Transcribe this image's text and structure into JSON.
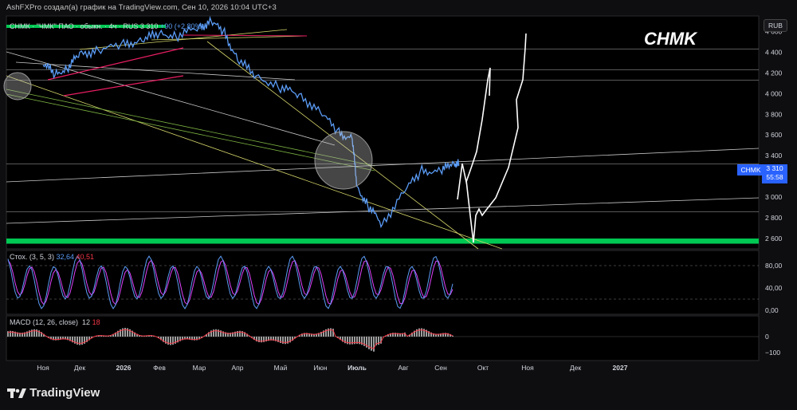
{
  "header": {
    "text": "AshFXPro создал(а) график на TradingView.com, Сен 10, 2026 10:04 UTC+3"
  },
  "symbol": {
    "legend": "СНМК · \"ЧМК\" ПАО · обыкн. · 4ч · RUS",
    "last": "3 310",
    "change": "+90 (+2,80%)"
  },
  "currency": "RUB",
  "annotation": "CHMK",
  "price_label": {
    "name": "CHMK",
    "value": "3 310",
    "countdown": "55:58"
  },
  "stoch": {
    "label": "Стох. (3, 5, 3)",
    "k": "32,64",
    "d": "40,51"
  },
  "macd": {
    "label": "MACD (12, 26, close)",
    "macd": "12",
    "signal": "18"
  },
  "brand": "TradingView",
  "colors": {
    "price": "#5b9cf6",
    "support": "#00c853",
    "stoch_k": "#5b9cf6",
    "stoch_d": "#e040fb",
    "hist": "#9e9e9e",
    "macd_line": "#f23645",
    "channel": "#e91e63"
  },
  "chart_data": [
    {
      "type": "line",
      "title": "СНМК · 4ч",
      "ylabel": "RUB",
      "x": [
        "Ноя",
        "Дек",
        "2026",
        "Фев",
        "Мар",
        "Апр",
        "Май",
        "Июн",
        "Июль",
        "Авг",
        "Сен",
        "Окт",
        "Ноя",
        "Дек",
        "2027"
      ],
      "ylim": [
        2500,
        4750
      ],
      "yticks": [
        "4 600",
        "4 400",
        "4 200",
        "4 000",
        "3 800",
        "3 600",
        "3 400",
        "3 200",
        "3 000",
        "2 800",
        "2 600"
      ],
      "ytick_values": [
        4600,
        4400,
        4200,
        4000,
        3800,
        3600,
        3400,
        3200,
        3000,
        2800,
        2600
      ],
      "series": [
        {
          "name": "СНМК",
          "points": [
            [
              "Ноя-01",
              4300
            ],
            [
              "Ноя-10",
              4180
            ],
            [
              "Ноя-20",
              4260
            ],
            [
              "Дек-01",
              4380
            ],
            [
              "Дек-15",
              4420
            ],
            [
              "2026-01",
              4470
            ],
            [
              "2026-15",
              4520
            ],
            [
              "Фев-01",
              4580
            ],
            [
              "Фев-15",
              4560
            ],
            [
              "Мар-01",
              4640
            ],
            [
              "Мар-10",
              4700
            ],
            [
              "Мар-20",
              4580
            ],
            [
              "Апр-01",
              4330
            ],
            [
              "Апр-15",
              4170
            ],
            [
              "Май-01",
              4060
            ],
            [
              "Май-15",
              3990
            ],
            [
              "Июн-01",
              3820
            ],
            [
              "Июн-15",
              3620
            ],
            [
              "Июн-25",
              3560
            ],
            [
              "Июль-01",
              3100
            ],
            [
              "Июль-10",
              2900
            ],
            [
              "Июль-20",
              2740
            ],
            [
              "Авг-01",
              3040
            ],
            [
              "Авг-15",
              3260
            ],
            [
              "Сен-01",
              3240
            ],
            [
              "Сен-10",
              3340
            ],
            [
              "Сен-15",
              3310
            ]
          ]
        }
      ],
      "support_zone": [
        2550,
        2600
      ],
      "horizontal_levels": [
        4430,
        4230,
        4130,
        3320,
        2860
      ],
      "forecast_drawing": "hand-drawn path: dip to ~2600, then rise to ~4700",
      "highlight_circles": 3
    },
    {
      "type": "line",
      "title": "Стох. (3, 5, 3)",
      "ylim": [
        0,
        100
      ],
      "yticks": [
        "80,00",
        "40,00",
        "0,00"
      ],
      "ytick_values": [
        80,
        40,
        0
      ],
      "bands": [
        80,
        20
      ],
      "series": [
        {
          "name": "%K",
          "last": 32.64
        },
        {
          "name": "%D",
          "last": 40.51
        }
      ]
    },
    {
      "type": "bar",
      "title": "MACD (12, 26, close)",
      "ylim": [
        -120,
        100
      ],
      "yticks": [
        "0",
        "−100"
      ],
      "ytick_values": [
        0,
        -100
      ],
      "series": [
        {
          "name": "MACD",
          "last": 12
        },
        {
          "name": "Signal",
          "last": 18
        }
      ]
    }
  ]
}
